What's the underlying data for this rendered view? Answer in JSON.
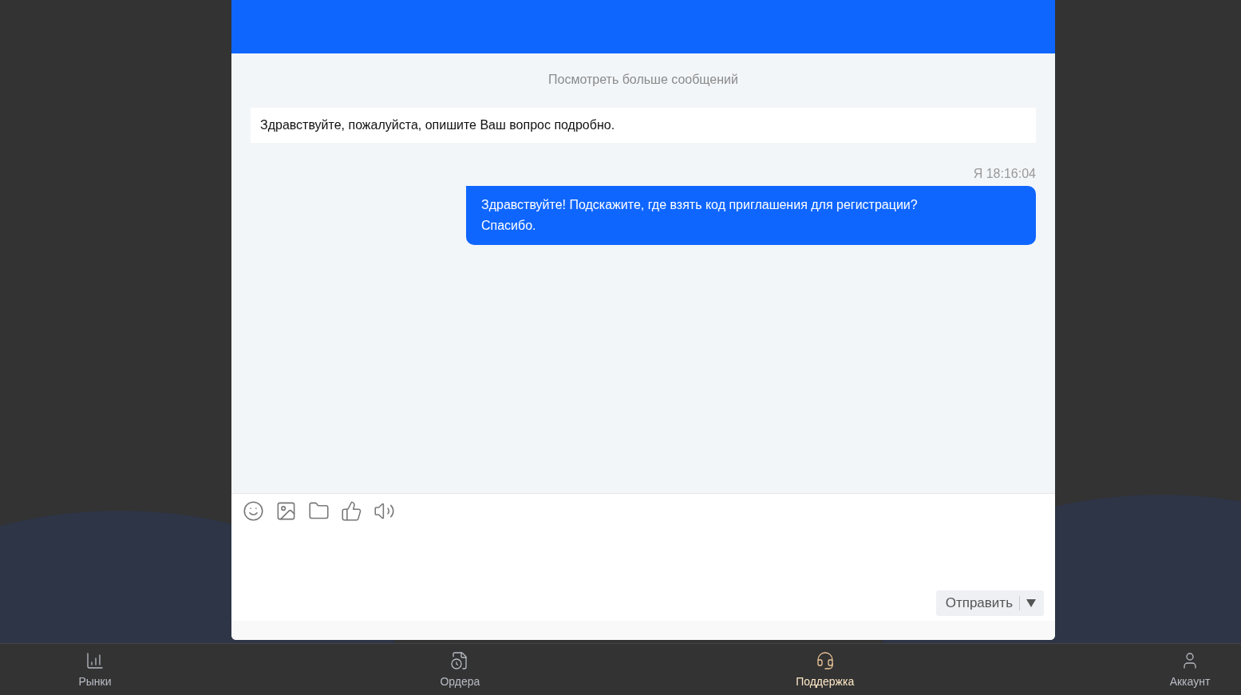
{
  "chat": {
    "load_more": "Посмотреть больше сообщений",
    "messages": [
      {
        "kind": "agent",
        "text": "Здравствуйте, пожалуйста, опишите Ваш вопрос подробно."
      },
      {
        "kind": "user",
        "meta": "Я 18:16:04",
        "text": "Здравствуйте! Подскажите, где взять код приглашения для регистрации? Спасибо."
      }
    ],
    "send_button": "Отправить"
  },
  "bottom_nav": [
    {
      "label": "Рынки",
      "selected": false
    },
    {
      "label": "Ордера",
      "selected": false
    },
    {
      "label": "Поддержка",
      "selected": true
    },
    {
      "label": "Аккаунт",
      "selected": false
    }
  ]
}
